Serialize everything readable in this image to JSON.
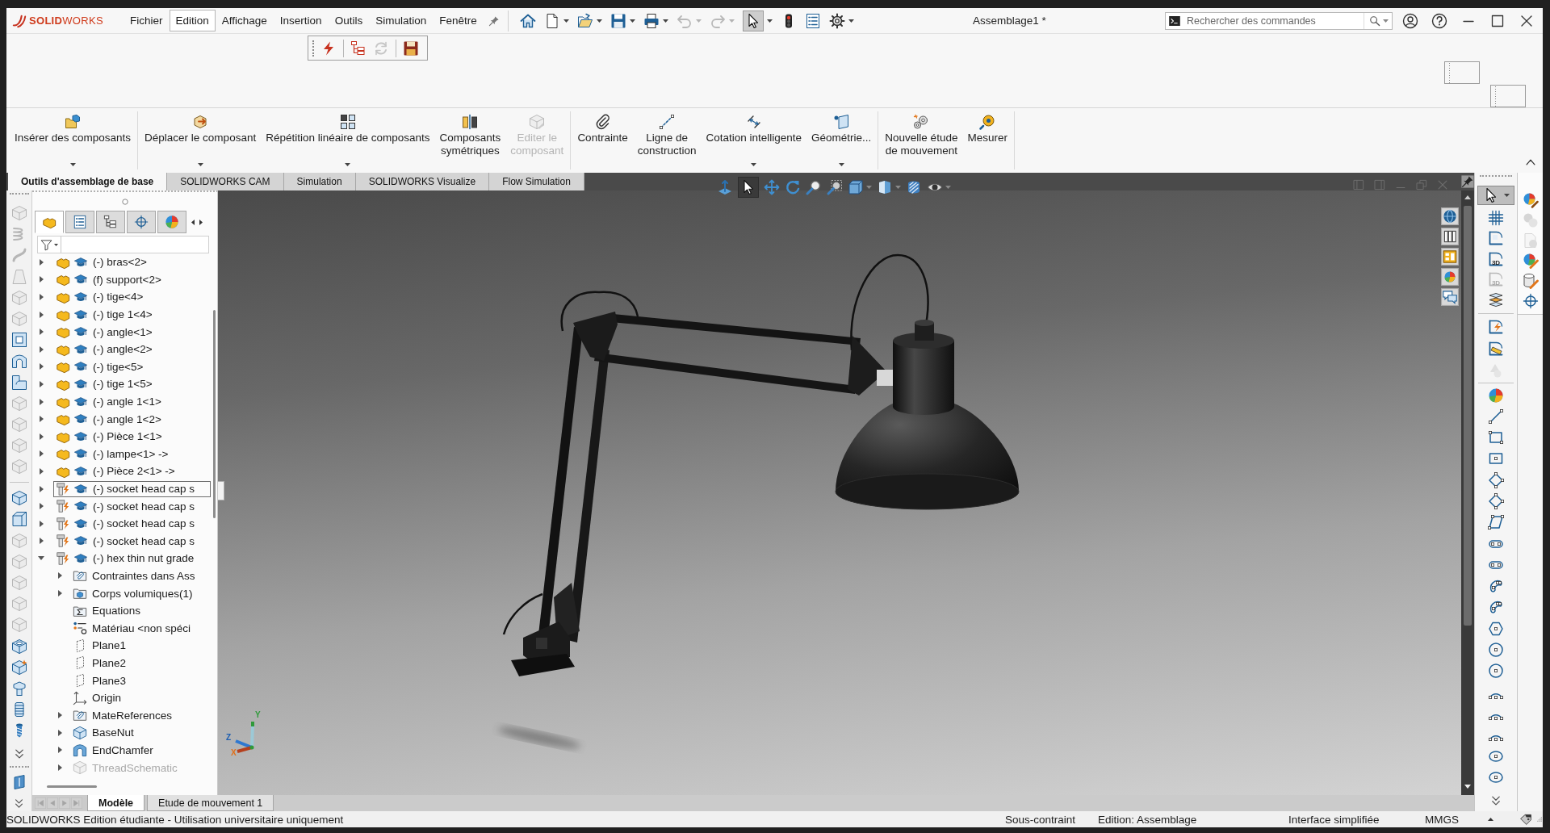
{
  "title_bar": {
    "logo": "**SOLID**WORKS",
    "menus": [
      {
        "label": "Fichier",
        "selected": false
      },
      {
        "label": "Edition",
        "selected": true
      },
      {
        "label": "Affichage",
        "selected": false
      },
      {
        "label": "Insertion",
        "selected": false
      },
      {
        "label": "Outils",
        "selected": false
      },
      {
        "label": "Simulation",
        "selected": false
      },
      {
        "label": "Fenêtre",
        "selected": false
      }
    ],
    "quick_access": [
      {
        "selected": false,
        "disabled": false,
        "dropdown": false
      },
      {
        "selected": false,
        "disabled": false,
        "dropdown": true
      },
      {
        "selected": false,
        "disabled": false,
        "dropdown": true
      },
      {
        "selected": false,
        "disabled": false,
        "dropdown": true
      },
      {
        "selected": false,
        "disabled": false,
        "dropdown": true
      },
      {
        "selected": false,
        "disabled": true,
        "dropdown": true
      },
      {
        "selected": false,
        "disabled": true,
        "dropdown": true
      },
      {
        "selected": true,
        "disabled": false,
        "dropdown": true
      },
      {
        "selected": false,
        "disabled": false,
        "dropdown": false
      },
      {
        "selected": false,
        "disabled": false,
        "dropdown": false
      },
      {
        "selected": false,
        "disabled": false,
        "dropdown": true
      }
    ],
    "document_title": "Assemblage1 *",
    "search": {
      "placeholder": "Rechercher des commandes"
    }
  },
  "floating_toolbar": [
    {
      "disabled": false
    },
    {
      "disabled": false
    },
    {
      "disabled": true
    },
    {
      "disabled": false
    }
  ],
  "ribbon": {
    "groups": [
      {
        "items": [
          {
            "label": "Insérer des composants",
            "dropdown": true,
            "disabled": false
          }
        ]
      },
      {
        "items": [
          {
            "label": "Déplacer le composant",
            "dropdown": true,
            "disabled": false
          },
          {
            "label": "Répétition linéaire de composants",
            "dropdown": true,
            "disabled": false
          },
          {
            "label": "Composants\nsymétriques",
            "dropdown": false,
            "disabled": false
          },
          {
            "label": "Editer le\ncomposant",
            "dropdown": false,
            "disabled": true
          }
        ]
      },
      {
        "items": [
          {
            "label": "Contrainte",
            "dropdown": false,
            "disabled": false
          },
          {
            "label": "Ligne de\nconstruction",
            "dropdown": false,
            "disabled": false
          },
          {
            "label": "Cotation intelligente",
            "dropdown": true,
            "disabled": false
          },
          {
            "label": "Géométrie...",
            "dropdown": true,
            "disabled": false
          }
        ]
      },
      {
        "items": [
          {
            "label": "Nouvelle étude\nde mouvement",
            "dropdown": false,
            "disabled": false
          },
          {
            "label": "Mesurer",
            "dropdown": false,
            "disabled": false
          }
        ]
      }
    ]
  },
  "command_tabs": [
    {
      "label": "Outils d'assemblage de base",
      "selected": true
    },
    {
      "label": "SOLIDWORKS CAM",
      "selected": false
    },
    {
      "label": "Simulation",
      "selected": false
    },
    {
      "label": "SOLIDWORKS Visualize",
      "selected": false
    },
    {
      "label": "Flow Simulation",
      "selected": false
    }
  ],
  "heads_up_toolbar": [
    {
      "selected": false,
      "dropdown": false
    },
    {
      "selected": true,
      "dropdown": false
    },
    {
      "selected": false,
      "dropdown": false
    },
    {
      "selected": false,
      "dropdown": false
    },
    {
      "selected": false,
      "dropdown": false
    },
    {
      "selected": false,
      "dropdown": false
    },
    {
      "selected": false,
      "dropdown": true
    },
    {
      "selected": false,
      "dropdown": true
    },
    {
      "selected": false,
      "dropdown": false
    },
    {
      "selected": false,
      "dropdown": true
    }
  ],
  "feature_toolbar": [
    [
      {
        "disabled": true
      },
      {
        "disabled": true
      },
      {
        "disabled": true
      },
      {
        "disabled": true
      },
      {
        "disabled": true
      },
      {
        "disabled": true
      },
      {
        "disabled": false
      },
      {
        "disabled": false
      },
      {
        "disabled": false
      },
      {
        "disabled": true
      },
      {
        "disabled": true
      },
      {
        "disabled": true
      },
      {
        "disabled": true
      }
    ],
    [
      {
        "disabled": false
      },
      {
        "disabled": false
      },
      {
        "disabled": true
      },
      {
        "disabled": true
      },
      {
        "disabled": true
      },
      {
        "disabled": true
      },
      {
        "disabled": true
      },
      {
        "disabled": false
      },
      {
        "disabled": false
      },
      {
        "disabled": false
      },
      {
        "disabled": false
      },
      {
        "disabled": false
      }
    ],
    [
      {
        "disabled": false
      }
    ]
  ],
  "feature_tree": {
    "panel_tabs": [
      {
        "selected": true
      },
      {
        "selected": false
      },
      {
        "selected": false
      },
      {
        "selected": false
      },
      {
        "selected": false
      }
    ],
    "items": [
      {
        "label": "(-) bras<2>",
        "kind": "part",
        "expanded": false,
        "selected": false
      },
      {
        "label": "(f) support<2>",
        "kind": "part",
        "expanded": false,
        "selected": false
      },
      {
        "label": "(-) tige<4>",
        "kind": "part",
        "expanded": false,
        "selected": false
      },
      {
        "label": "(-) tige 1<4>",
        "kind": "part",
        "expanded": false,
        "selected": false
      },
      {
        "label": "(-) angle<1>",
        "kind": "part",
        "expanded": false,
        "selected": false
      },
      {
        "label": "(-) angle<2>",
        "kind": "part",
        "expanded": false,
        "selected": false
      },
      {
        "label": "(-) tige<5>",
        "kind": "part",
        "expanded": false,
        "selected": false
      },
      {
        "label": "(-) tige 1<5>",
        "kind": "part",
        "expanded": false,
        "selected": false
      },
      {
        "label": "(-) angle 1<1>",
        "kind": "part",
        "expanded": false,
        "selected": false
      },
      {
        "label": "(-) angle 1<2>",
        "kind": "part",
        "expanded": false,
        "selected": false
      },
      {
        "label": "(-) Pièce 1<1>",
        "kind": "part",
        "expanded": false,
        "selected": false
      },
      {
        "label": "(-) lampe<1> ->",
        "kind": "part",
        "expanded": false,
        "selected": false
      },
      {
        "label": "(-) Pièce 2<1> ->",
        "kind": "part",
        "expanded": false,
        "selected": false
      },
      {
        "label": "(-) socket head cap s",
        "kind": "toolbox_part",
        "expanded": false,
        "selected": true
      },
      {
        "label": "(-) socket head cap s",
        "kind": "toolbox_part",
        "expanded": false,
        "selected": false
      },
      {
        "label": "(-) socket head cap s",
        "kind": "toolbox_part",
        "expanded": false,
        "selected": false
      },
      {
        "label": "(-) socket head cap s",
        "kind": "toolbox_part",
        "expanded": false,
        "selected": false
      },
      {
        "label": "(-) hex thin nut grade",
        "kind": "toolbox_part",
        "expanded": true,
        "selected": false,
        "children": [
          {
            "label": "Contraintes dans Ass",
            "kind": "mates_folder",
            "expanded": false,
            "selected": false,
            "suppressed": false
          },
          {
            "label": "Corps volumiques(1)",
            "kind": "bodies_folder",
            "expanded": false,
            "selected": false,
            "suppressed": false
          },
          {
            "label": "Equations",
            "kind": "equations",
            "selected": false,
            "suppressed": false
          },
          {
            "label": "Matériau <non spéci",
            "kind": "material",
            "selected": false,
            "suppressed": false
          },
          {
            "label": "Plane1",
            "kind": "plane",
            "selected": false,
            "suppressed": false
          },
          {
            "label": "Plane2",
            "kind": "plane",
            "selected": false,
            "suppressed": false
          },
          {
            "label": "Plane3",
            "kind": "plane",
            "selected": false,
            "suppressed": false
          },
          {
            "label": "Origin",
            "kind": "origin",
            "selected": false,
            "suppressed": false
          },
          {
            "label": "MateReferences",
            "kind": "mates_folder",
            "expanded": false,
            "selected": false,
            "suppressed": false
          },
          {
            "label": "BaseNut",
            "kind": "feature",
            "expanded": false,
            "selected": false,
            "suppressed": false
          },
          {
            "label": "EndChamfer",
            "kind": "chamfer",
            "expanded": false,
            "selected": false,
            "suppressed": false
          },
          {
            "label": "ThreadSchematic",
            "kind": "feature",
            "expanded": false,
            "selected": false,
            "suppressed": true
          }
        ]
      }
    ]
  },
  "triad": {
    "labels": [
      "Y",
      "Z",
      "X"
    ]
  },
  "sketch_toolbar": [
    [
      {
        "selected": true,
        "disabled": false
      },
      {
        "selected": false,
        "disabled": false
      },
      {
        "selected": false,
        "disabled": false
      },
      {
        "selected": false,
        "disabled": false,
        "label": "3D"
      },
      {
        "selected": false,
        "disabled": true,
        "label": "3D"
      },
      {
        "selected": false,
        "disabled": false
      }
    ],
    [
      {
        "selected": false,
        "disabled": false
      },
      {
        "selected": false,
        "disabled": false
      },
      {
        "selected": false,
        "disabled": true
      }
    ],
    [
      {
        "selected": false,
        "disabled": false
      },
      {
        "selected": false,
        "disabled": false
      },
      {
        "selected": false,
        "disabled": false
      },
      {
        "selected": false,
        "disabled": false
      },
      {
        "selected": false,
        "disabled": false
      },
      {
        "selected": false,
        "disabled": false
      },
      {
        "selected": false,
        "disabled": false
      },
      {
        "selected": false,
        "disabled": false
      },
      {
        "selected": false,
        "disabled": false
      },
      {
        "selected": false,
        "disabled": false
      },
      {
        "selected": false,
        "disabled": false
      },
      {
        "selected": false,
        "disabled": false
      },
      {
        "selected": false,
        "disabled": false
      },
      {
        "selected": false,
        "disabled": false
      },
      {
        "selected": false,
        "disabled": false
      },
      {
        "selected": false,
        "disabled": false
      },
      {
        "selected": false,
        "disabled": false
      },
      {
        "selected": false,
        "disabled": false
      },
      {
        "selected": false,
        "disabled": false
      }
    ]
  ],
  "appearance_toolbar": [
    {
      "disabled": false
    },
    {
      "disabled": true
    },
    {
      "disabled": true
    },
    {
      "disabled": false
    },
    {
      "disabled": false
    },
    {
      "disabled": false
    }
  ],
  "bottom_tabs": {
    "nav": [
      {
        "disabled": true
      },
      {
        "disabled": true
      },
      {
        "disabled": true
      },
      {
        "disabled": true
      }
    ],
    "tabs": [
      {
        "label": "Modèle",
        "selected": true
      },
      {
        "label": "Etude de mouvement 1",
        "selected": false
      }
    ]
  },
  "status_bar": {
    "message": "SOLIDWORKS Edition étudiante - Utilisation universitaire uniquement",
    "fields": [
      "Sous-contraint",
      "Edition: Assemblage",
      "Interface simplifiée",
      "MMGS"
    ]
  }
}
